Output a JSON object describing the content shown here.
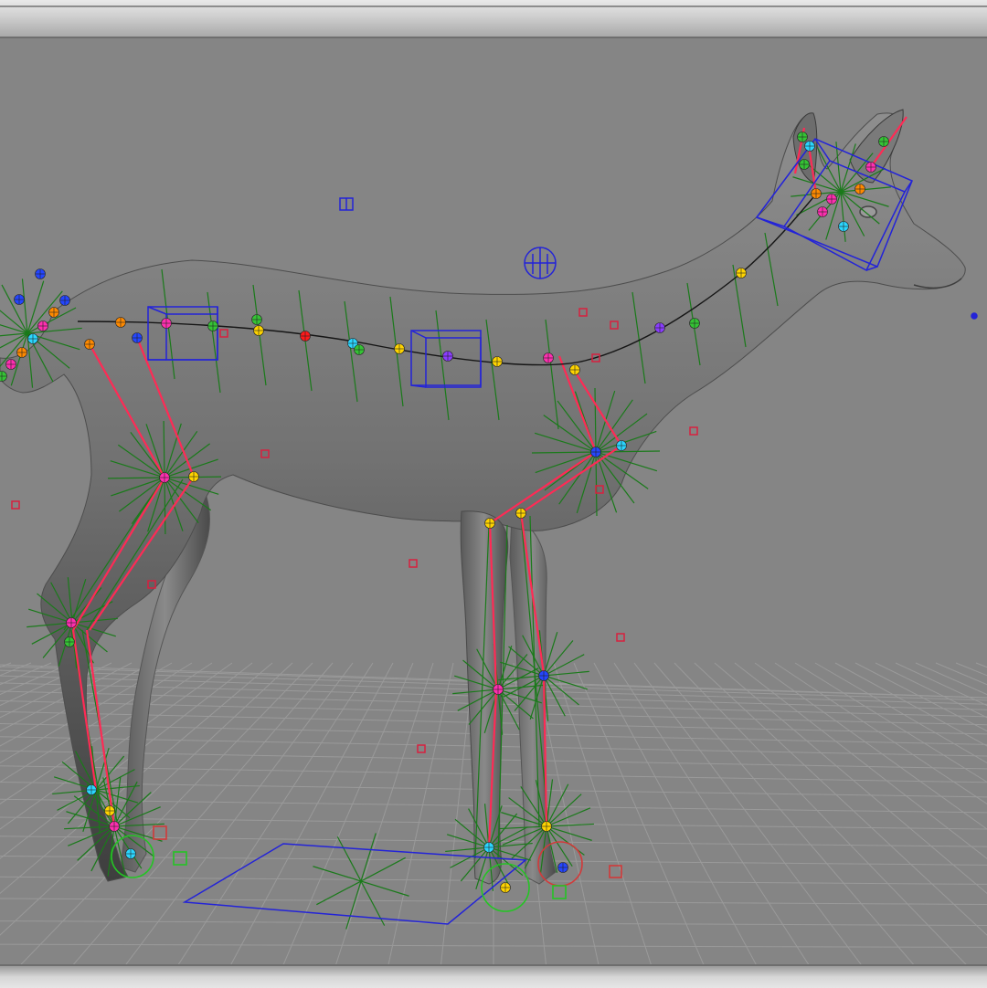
{
  "window": {
    "title": ""
  },
  "viewport": {
    "name": "perspective-viewport",
    "background": "#858585",
    "grid_color": "#9a9a9a",
    "mesh_color": "#6b6b6b"
  },
  "rig": {
    "subject": "deer",
    "joint_colors": [
      "#ff2fb0",
      "#ffd400",
      "#ff8a00",
      "#2bd6ff",
      "#35c435",
      "#2446ff",
      "#8a3dff",
      "#ff1a1a"
    ],
    "bone_color": "#ff2a55",
    "control_color": "#1a7a1a",
    "handle_color": "#1d1dd6"
  }
}
